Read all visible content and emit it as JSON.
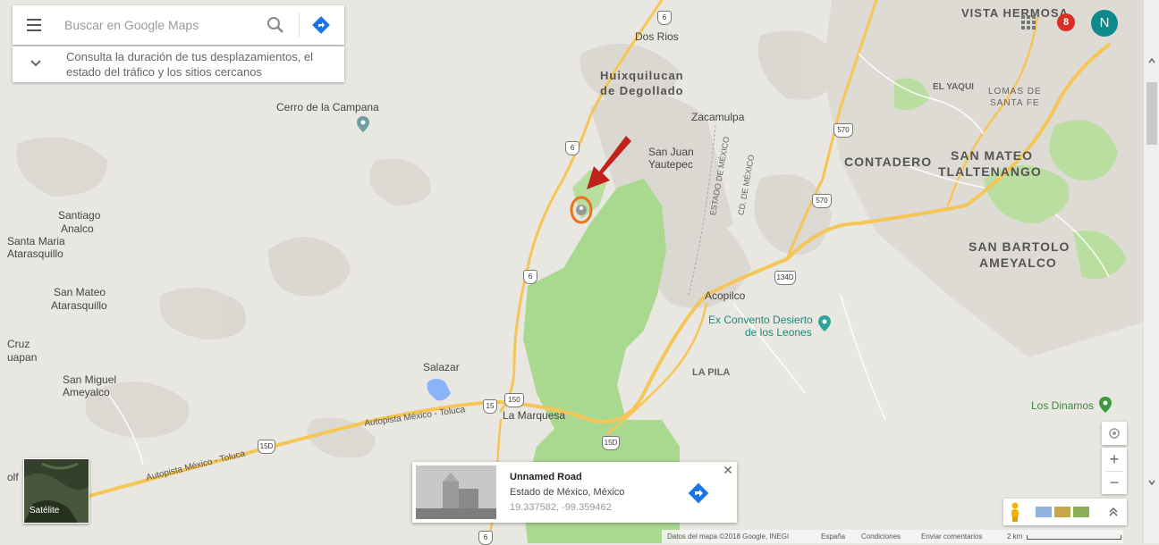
{
  "search": {
    "placeholder": "Buscar en Google Maps",
    "hint": "Consulta la duración de tus desplazamientos, el estado del tráfico y los sitios cercanos"
  },
  "header": {
    "notification_count": "8",
    "avatar_initial": "N"
  },
  "map_labels": {
    "vista_hermosa": "VISTA HERMOSA",
    "dos_rios": "Dos Rios",
    "huixquilucan": "Huixquilucan",
    "de_degollado": "de Degollado",
    "el_yaqui": "EL YAQUI",
    "lomas_de": "LOMAS DE",
    "santa_fe": "SANTA FE",
    "zacamulpa": "Zacamulpa",
    "san_juan": "San Juan",
    "yautepec": "Yautepec",
    "contadero": "CONTADERO",
    "san_mateo_1": "SAN MATEO",
    "tlaltenango": "TLALTENANGO",
    "cerro": "Cerro de la Campana",
    "santiago": "Santiago",
    "analco": "Analco",
    "santa_maria": "Santa Maria",
    "atarasquillo": "Atarasquillo",
    "san_mateo_2": "San Mateo",
    "atarasquillo_2": "Atarasquillo",
    "cruz": "Cruz",
    "uapan": "uapan",
    "san_miguel": "San Miguel",
    "ameyalco": "Ameyalco",
    "salazar": "Salazar",
    "la_marquesa": "La Marquesa",
    "acopilco": "Acopilco",
    "ex_convento": "Ex Convento Desierto",
    "de_los_leones": "de los Leones",
    "la_pila": "LA PILA",
    "san_bartolo": "SAN BARTOLO",
    "ameyalco_2": "AMEYALCO",
    "los_dinamos": "Los Dinamos",
    "autopista_1": "Autopista México - Toluca",
    "autopista_2": "Autopista México - Toluca",
    "estado_de_mexico": "ESTADO DE MÉXICO",
    "cd_de_mexico": "CD. DE MÉXICO",
    "golf": "olf"
  },
  "shields": [
    "6",
    "6",
    "6",
    "570",
    "570",
    "134D",
    "15D",
    "150",
    "15",
    "15D",
    "6"
  ],
  "card": {
    "title": "Unnamed Road",
    "subtitle": "Estado de México, México",
    "coords": "19.337582, -99.359462"
  },
  "satellite_label": "Satélite",
  "footer": {
    "data": "Datos del mapa ©2018 Google, INEGI",
    "country": "España",
    "terms": "Condiciones",
    "feedback": "Enviar comentarios",
    "scale": "2 km"
  },
  "colors": {
    "marker": "#e8741c",
    "arrow": "#c0231b",
    "park": "#a9d88f",
    "road": "#f7c95c",
    "water": "#8ab4f8"
  }
}
